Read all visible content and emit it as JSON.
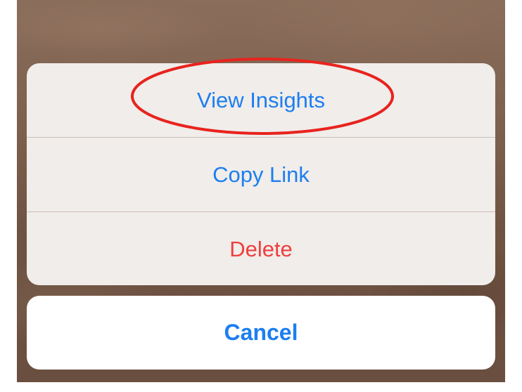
{
  "action_sheet": {
    "actions": [
      {
        "label": "View Insights",
        "style": "default"
      },
      {
        "label": "Copy Link",
        "style": "default"
      },
      {
        "label": "Delete",
        "style": "destructive"
      }
    ],
    "cancel_label": "Cancel"
  },
  "annotation": {
    "shape": "ellipse",
    "color": "#e8231e",
    "target": "View Insights"
  },
  "colors": {
    "action_blue": "#1d7ef0",
    "destructive_red": "#ee3f3f",
    "sheet_background": "#f0edea",
    "cancel_background": "#ffffff"
  }
}
